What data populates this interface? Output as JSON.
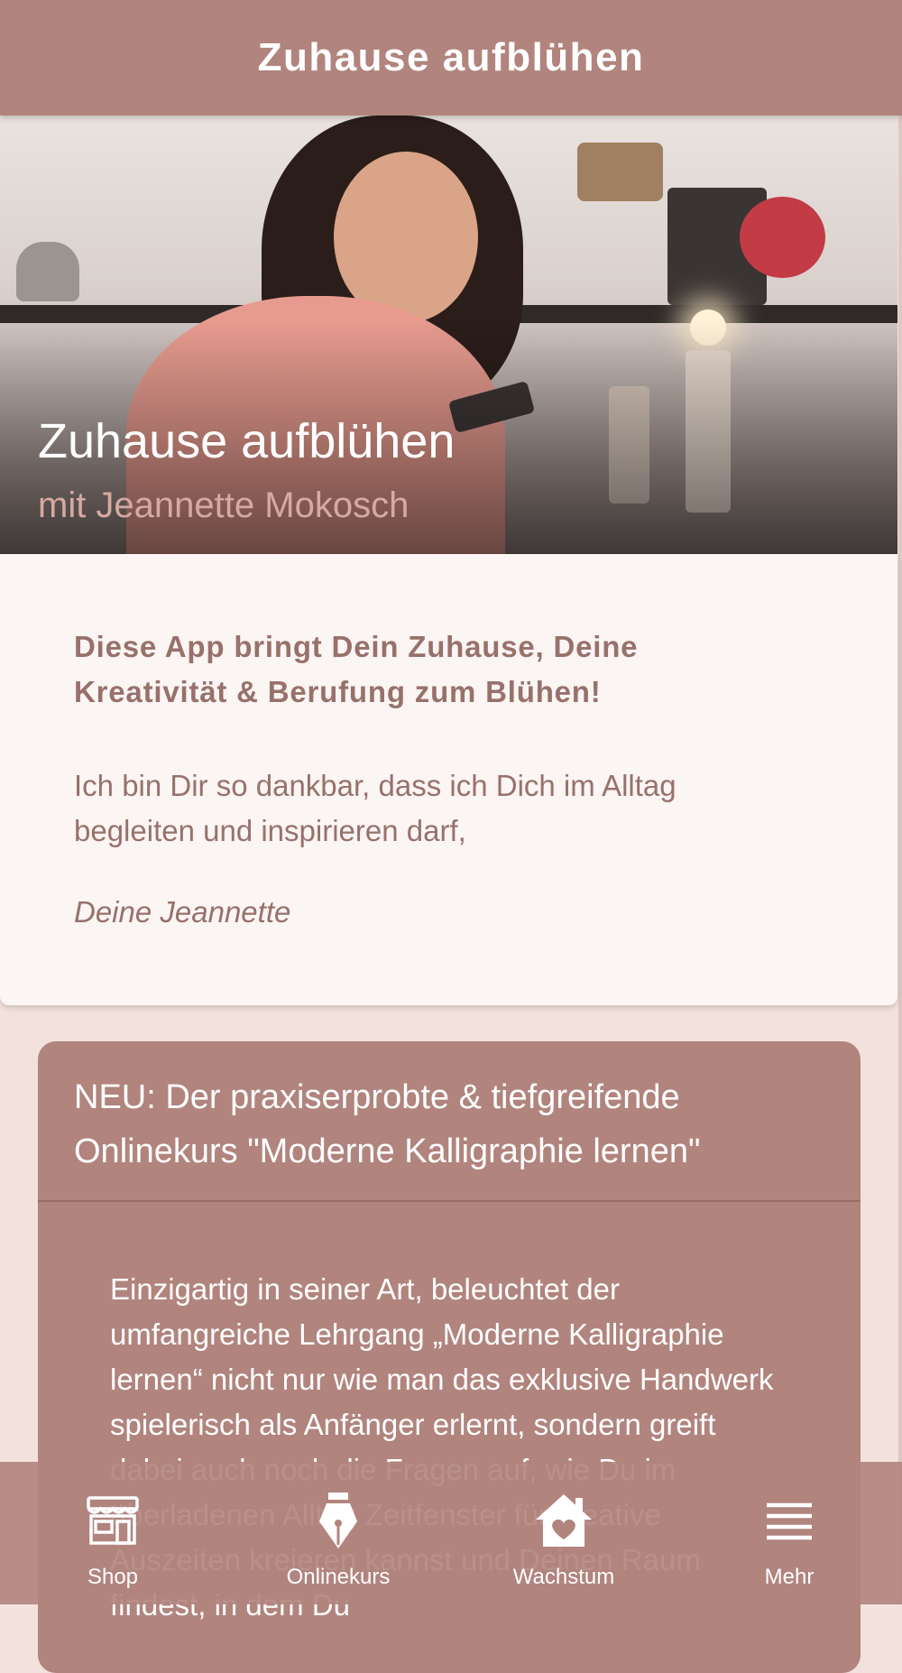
{
  "header": {
    "title": "Zuhause aufblühen"
  },
  "hero": {
    "title": "Zuhause aufblühen",
    "subtitle": "mit Jeannette Mokosch"
  },
  "intro": {
    "headline": "Diese App bringt Dein Zuhause, Deine Kreativität & Berufung zum Blühen!",
    "body": "Ich bin Dir so dankbar, dass ich Dich im Alltag begleiten und inspirieren darf,",
    "signature": "Deine Jeannette"
  },
  "course": {
    "title": "NEU: Der praxiserprobte & tiefgreifende Onlinekurs \"Moderne Kalligraphie lernen\"",
    "body": "Einzigartig in seiner Art, beleuchtet der umfangreiche Lehrgang „Moderne Kalligraphie lernen“ nicht nur wie man das exklusive Handwerk spielerisch als Anfänger erlernt, sondern greift dabei auch noch die Fragen auf, wie Du im überladenen Alltag Zeitfenster für kreative Auszeiten kreieren kannst und Deinen Raum findest, in dem Du"
  },
  "tabbar": {
    "items": [
      {
        "label": "Shop",
        "icon": "storefront-icon"
      },
      {
        "label": "Onlinekurs",
        "icon": "fountain-pen-icon"
      },
      {
        "label": "Wachstum",
        "icon": "home-heart-icon"
      },
      {
        "label": "Mehr",
        "icon": "menu-icon"
      }
    ]
  },
  "colors": {
    "primary": "#b1847e",
    "background": "#f3e1dd",
    "card": "#fbf5f4",
    "text_muted": "#98716b"
  }
}
